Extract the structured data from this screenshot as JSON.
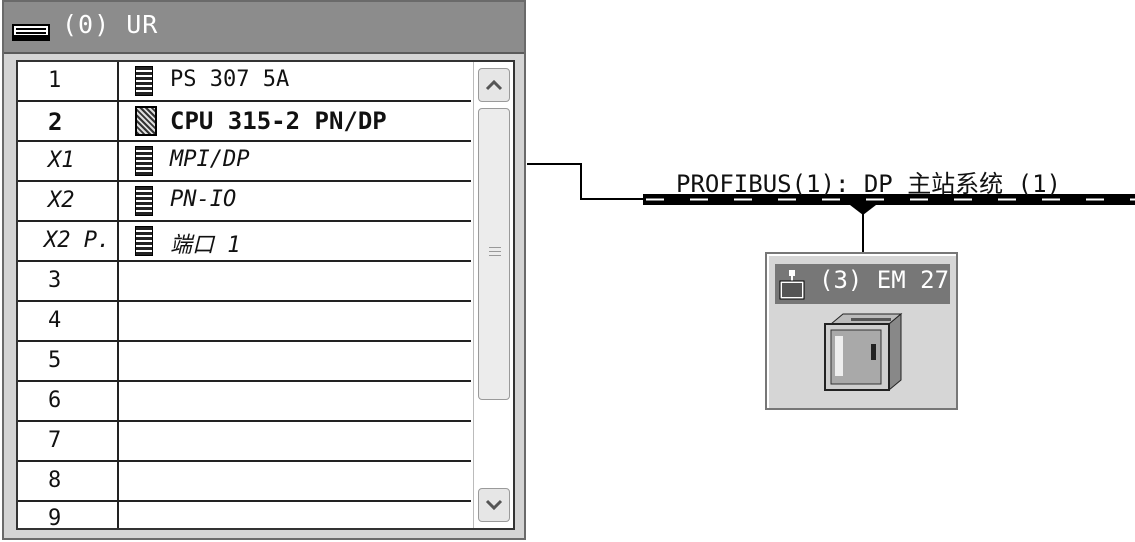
{
  "rack": {
    "title": "(0) UR",
    "rows": [
      {
        "slot": "1",
        "module": "PS 307 5A",
        "style": "normal",
        "icon": "module-icon"
      },
      {
        "slot": "2",
        "module": "CPU 315-2 PN/DP",
        "style": "bold",
        "icon": "cpu-module-icon"
      },
      {
        "slot": "X1",
        "module": "MPI/DP",
        "style": "italic",
        "icon": "module-icon"
      },
      {
        "slot": "X2",
        "module": "PN-IO",
        "style": "italic",
        "icon": "module-icon"
      },
      {
        "slot": "X2 P.",
        "module": "端口 1",
        "style": "italic",
        "icon": "module-icon"
      },
      {
        "slot": "3",
        "module": ""
      },
      {
        "slot": "4",
        "module": ""
      },
      {
        "slot": "5",
        "module": ""
      },
      {
        "slot": "6",
        "module": ""
      },
      {
        "slot": "7",
        "module": ""
      },
      {
        "slot": "8",
        "module": ""
      },
      {
        "slot": "9",
        "module": ""
      }
    ]
  },
  "network": {
    "bus_label": "PROFIBUS(1): DP 主站系统 (1)",
    "station": {
      "title": "(3) EM 27"
    }
  },
  "icons": {
    "rack": "rack-icon",
    "scroll_up": "chevron-up-icon",
    "scroll_down": "chevron-down-icon",
    "station": "dp-slave-icon",
    "device": "em-module-device-icon"
  }
}
